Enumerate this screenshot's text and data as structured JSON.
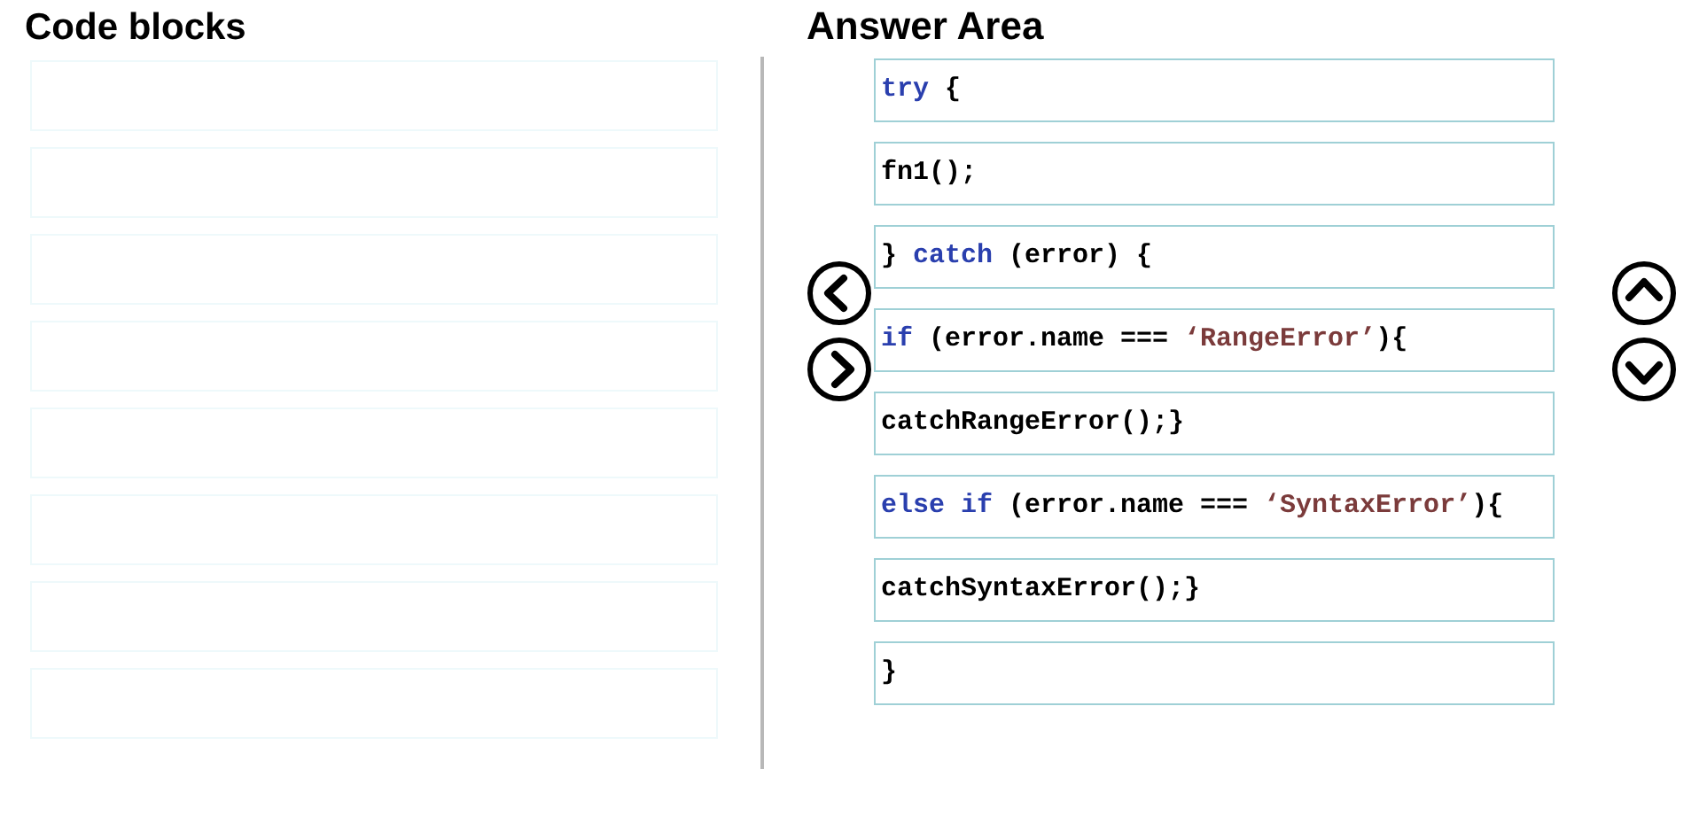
{
  "code_blocks": {
    "title": "Code blocks"
  },
  "answer_area": {
    "title": "Answer Area",
    "lines": [
      [
        {
          "kind": "keyword",
          "text": "try"
        },
        {
          "kind": "plain",
          "text": " {"
        }
      ],
      [
        {
          "kind": "plain",
          "text": "fn1();"
        }
      ],
      [
        {
          "kind": "plain",
          "text": "} "
        },
        {
          "kind": "keyword",
          "text": "catch"
        },
        {
          "kind": "plain",
          "text": " (error) {"
        }
      ],
      [
        {
          "kind": "keyword",
          "text": "if"
        },
        {
          "kind": "plain",
          "text": " (error.name === "
        },
        {
          "kind": "string",
          "text": "‘RangeError’"
        },
        {
          "kind": "plain",
          "text": "){"
        }
      ],
      [
        {
          "kind": "plain",
          "text": "catchRangeError();}"
        }
      ],
      [
        {
          "kind": "keyword",
          "text": "else if"
        },
        {
          "kind": "plain",
          "text": " (error.name === "
        },
        {
          "kind": "string",
          "text": "‘SyntaxError’"
        },
        {
          "kind": "plain",
          "text": "){"
        }
      ],
      [
        {
          "kind": "plain",
          "text": "catchSyntaxError();}"
        }
      ],
      [
        {
          "kind": "plain",
          "text": "}"
        }
      ]
    ]
  }
}
